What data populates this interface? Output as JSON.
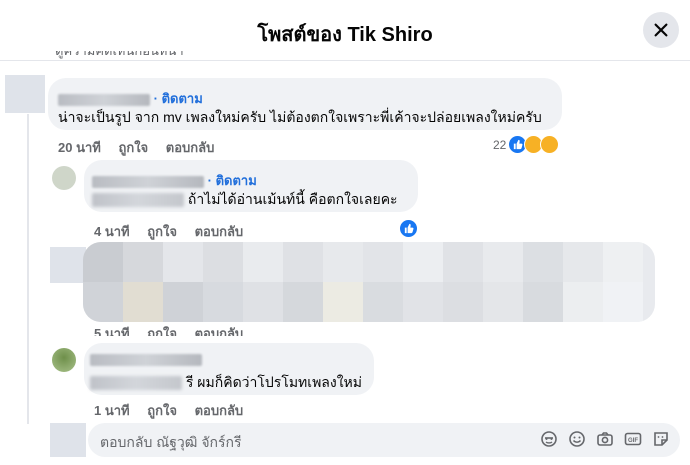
{
  "header": {
    "title": "โพสต์ของ Tik Shiro"
  },
  "partial_top_text": "ดูความคิดเห็นก่อนหน้า",
  "comments": [
    {
      "author_visible": "ณัฐวุฒิ  จักรกรี",
      "follow": "· ติดตาม",
      "text": "น่าจะเป็นรูป จาก mv เพลงใหม่ครับ ไม่ต้องตกใจเพราะพี่เค้าจะปล่อยเพลงใหม่ครับ",
      "time": "20 นาที",
      "like": "ถูกใจ",
      "reply": "ตอบกลับ",
      "reaction_count": "22"
    },
    {
      "follow": "· ติดตาม",
      "text_visible": "ถ้าไม่ได้อ่านเม้นท์นี้ คือตกใจเลยคะ",
      "time": "4 นาที",
      "like": "ถูกใจ",
      "reply": "ตอบกลับ"
    },
    {
      "time": "5 นาที",
      "like": "ถูกใจ",
      "reply": "ตอบกลับ"
    },
    {
      "text_visible": "รี ผมก็คิดว่าโปรโมทเพลงใหม่",
      "time": "1 นาที",
      "like": "ถูกใจ",
      "reply": "ตอบกลับ"
    }
  ],
  "reply_box": {
    "placeholder": "ตอบกลับ ณัฐวุฒิ จักร์กรี"
  },
  "reply_icons": [
    "avatar-sticker-icon",
    "emoji-icon",
    "camera-icon",
    "gif-icon",
    "sticker-icon"
  ],
  "colors": {
    "link": "#216fdb",
    "like": "#1877f2",
    "bubble": "#f0f2f5",
    "muted": "#65676b"
  }
}
